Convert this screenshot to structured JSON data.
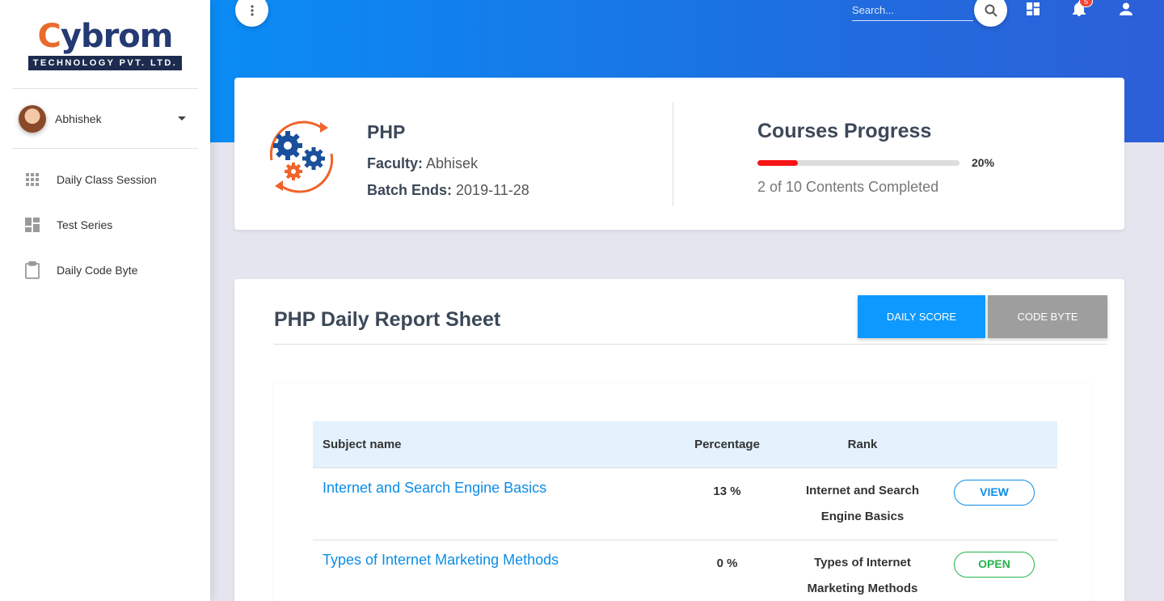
{
  "brand": {
    "logo_word": "ybrom",
    "logo_c": "C",
    "logo_sub": "TECHNOLOGY PVT. LTD."
  },
  "user": {
    "name": "Abhishek"
  },
  "sidebar": {
    "items": [
      {
        "label": "Daily Class Session",
        "icon": "apps-grid-icon"
      },
      {
        "label": "Test Series",
        "icon": "dashboard-icon"
      },
      {
        "label": "Daily Code Byte",
        "icon": "clipboard-icon"
      }
    ]
  },
  "header": {
    "search_placeholder": "Search...",
    "notification_count": "5"
  },
  "course": {
    "title": "PHP",
    "faculty_label": "Faculty:",
    "faculty": "Abhisek",
    "batch_label": "Batch Ends:",
    "batch_end": "2019-11-28"
  },
  "progress": {
    "title": "Courses Progress",
    "percent": 20,
    "percent_label": "20%",
    "subtitle": "2 of 10 Contents Completed"
  },
  "report": {
    "title": "PHP Daily Report Sheet",
    "daily_score_label": "DAILY SCORE",
    "code_byte_label": "CODE BYTE",
    "columns": [
      "Subject name",
      "Percentage",
      "Rank"
    ],
    "rows": [
      {
        "subject": "Internet and Search Engine Basics",
        "percentage": "13 %",
        "rank": "Internet and Search Engine Basics",
        "action": "VIEW"
      },
      {
        "subject": "Types of Internet Marketing Methods",
        "percentage": "0 %",
        "rank": "Types of Internet Marketing Methods",
        "action": "OPEN"
      }
    ]
  },
  "colors": {
    "primary": "#0d99ff",
    "progress": "#f51414",
    "open": "#23b34a",
    "header_start": "#0a8cf5",
    "header_end": "#2d5fd8"
  }
}
